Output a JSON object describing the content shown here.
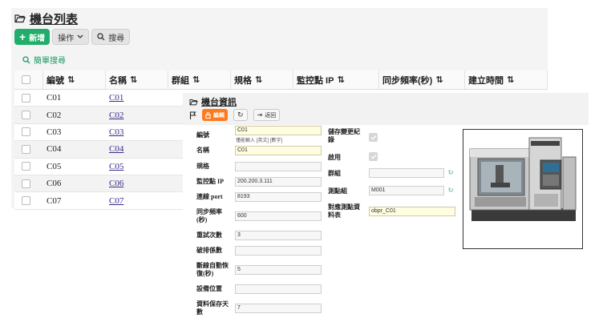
{
  "list": {
    "title": "機台列表",
    "toolbar": {
      "add": "新增",
      "actions": "操作",
      "search": "搜尋"
    },
    "simple_search": "簡單搜尋",
    "columns": [
      "編號",
      "名稱",
      "群組",
      "規格",
      "監控點 IP",
      "同步頻率(秒)",
      "建立時間"
    ],
    "rows": [
      {
        "code": "C01",
        "name": "C01"
      },
      {
        "code": "C02",
        "name": "C02"
      },
      {
        "code": "C03",
        "name": "C03"
      },
      {
        "code": "C04",
        "name": "C04"
      },
      {
        "code": "C05",
        "name": "C05"
      },
      {
        "code": "C06",
        "name": "C06"
      },
      {
        "code": "C07",
        "name": "C07"
      }
    ]
  },
  "detail": {
    "title": "機台資訊",
    "edit": "編輯",
    "back": "返回",
    "fields": {
      "code": {
        "label": "編號",
        "value": "C01",
        "hint": "僅能輸入 [英文] [數字]"
      },
      "name": {
        "label": "名稱",
        "value": "C01"
      },
      "spec": {
        "label": "規格",
        "value": ""
      },
      "ip": {
        "label": "監控點 IP",
        "value": "200.200.3.111"
      },
      "port": {
        "label": "連線 port",
        "value": "8193"
      },
      "sync": {
        "label": "同步頻率\n(秒)",
        "value": "600"
      },
      "retry": {
        "label": "重試次數",
        "value": "3"
      },
      "break": {
        "label": "破排係數",
        "value": ""
      },
      "reconnect": {
        "label": "斷線自動恢\n復(秒)",
        "value": "5"
      },
      "location": {
        "label": "設備位置",
        "value": ""
      },
      "retain": {
        "label": "資料保存天\n數",
        "value": "7"
      },
      "store_log": {
        "label": "儲存變更紀\n錄"
      },
      "enabled": {
        "label": "啟用"
      },
      "group": {
        "label": "群組",
        "value": ""
      },
      "point_group": {
        "label": "測點組",
        "value": "M001"
      },
      "map_table": {
        "label": "對應測點資\n料表",
        "value": "obpr_C01"
      }
    }
  },
  "colors": {
    "accent_green": "#21ad6b",
    "edit_orange": "#ff7a1c",
    "link_purple": "#3b2b8a"
  }
}
